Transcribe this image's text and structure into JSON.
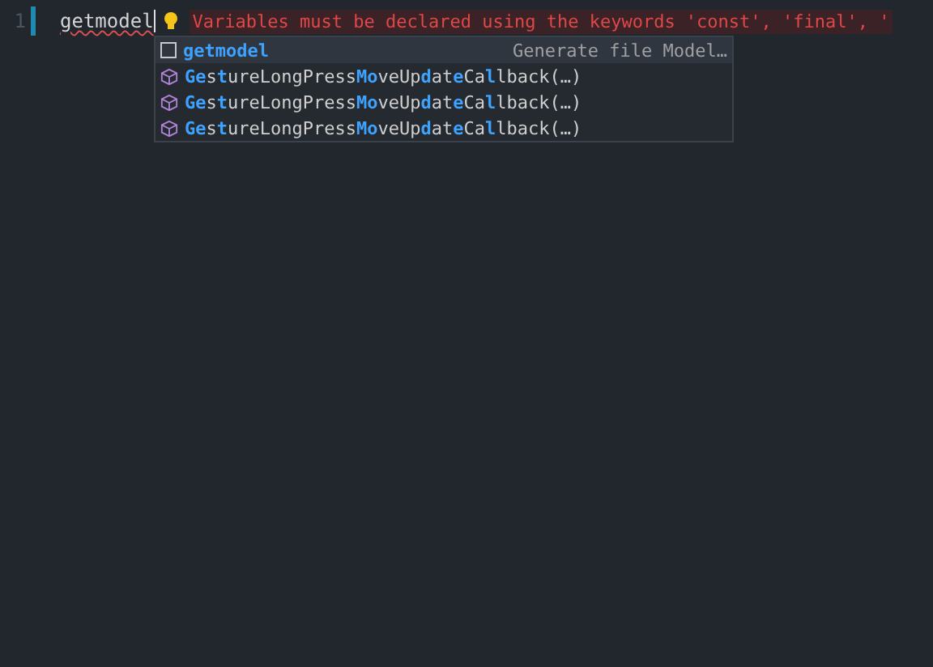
{
  "editor": {
    "line_number": "1",
    "code": "getmodel",
    "diagnostic": "Variables must be declared using the keywords 'const', 'final', '"
  },
  "suggestions": [
    {
      "kind": "file",
      "selected": true,
      "segments": [
        {
          "text": "getmodel",
          "match": true
        }
      ],
      "detail": "Generate file Model…"
    },
    {
      "kind": "class",
      "selected": false,
      "segments": [
        {
          "text": "Ge",
          "match": true
        },
        {
          "text": "s",
          "match": false
        },
        {
          "text": "t",
          "match": true
        },
        {
          "text": "ureLongPress",
          "match": false
        },
        {
          "text": "Mo",
          "match": true
        },
        {
          "text": "veUp",
          "match": false
        },
        {
          "text": "d",
          "match": true
        },
        {
          "text": "at",
          "match": false
        },
        {
          "text": "e",
          "match": true
        },
        {
          "text": "Ca",
          "match": false
        },
        {
          "text": "l",
          "match": true
        },
        {
          "text": "lback(…)",
          "match": false
        }
      ]
    },
    {
      "kind": "class",
      "selected": false,
      "segments": [
        {
          "text": "Ge",
          "match": true
        },
        {
          "text": "s",
          "match": false
        },
        {
          "text": "t",
          "match": true
        },
        {
          "text": "ureLongPress",
          "match": false
        },
        {
          "text": "Mo",
          "match": true
        },
        {
          "text": "veUp",
          "match": false
        },
        {
          "text": "d",
          "match": true
        },
        {
          "text": "at",
          "match": false
        },
        {
          "text": "e",
          "match": true
        },
        {
          "text": "Ca",
          "match": false
        },
        {
          "text": "l",
          "match": true
        },
        {
          "text": "lback(…)",
          "match": false
        }
      ]
    },
    {
      "kind": "class",
      "selected": false,
      "segments": [
        {
          "text": "Ge",
          "match": true
        },
        {
          "text": "s",
          "match": false
        },
        {
          "text": "t",
          "match": true
        },
        {
          "text": "ureLongPress",
          "match": false
        },
        {
          "text": "Mo",
          "match": true
        },
        {
          "text": "veUp",
          "match": false
        },
        {
          "text": "d",
          "match": true
        },
        {
          "text": "at",
          "match": false
        },
        {
          "text": "e",
          "match": true
        },
        {
          "text": "Ca",
          "match": false
        },
        {
          "text": "l",
          "match": true
        },
        {
          "text": "lback(…)",
          "match": false
        }
      ]
    }
  ]
}
